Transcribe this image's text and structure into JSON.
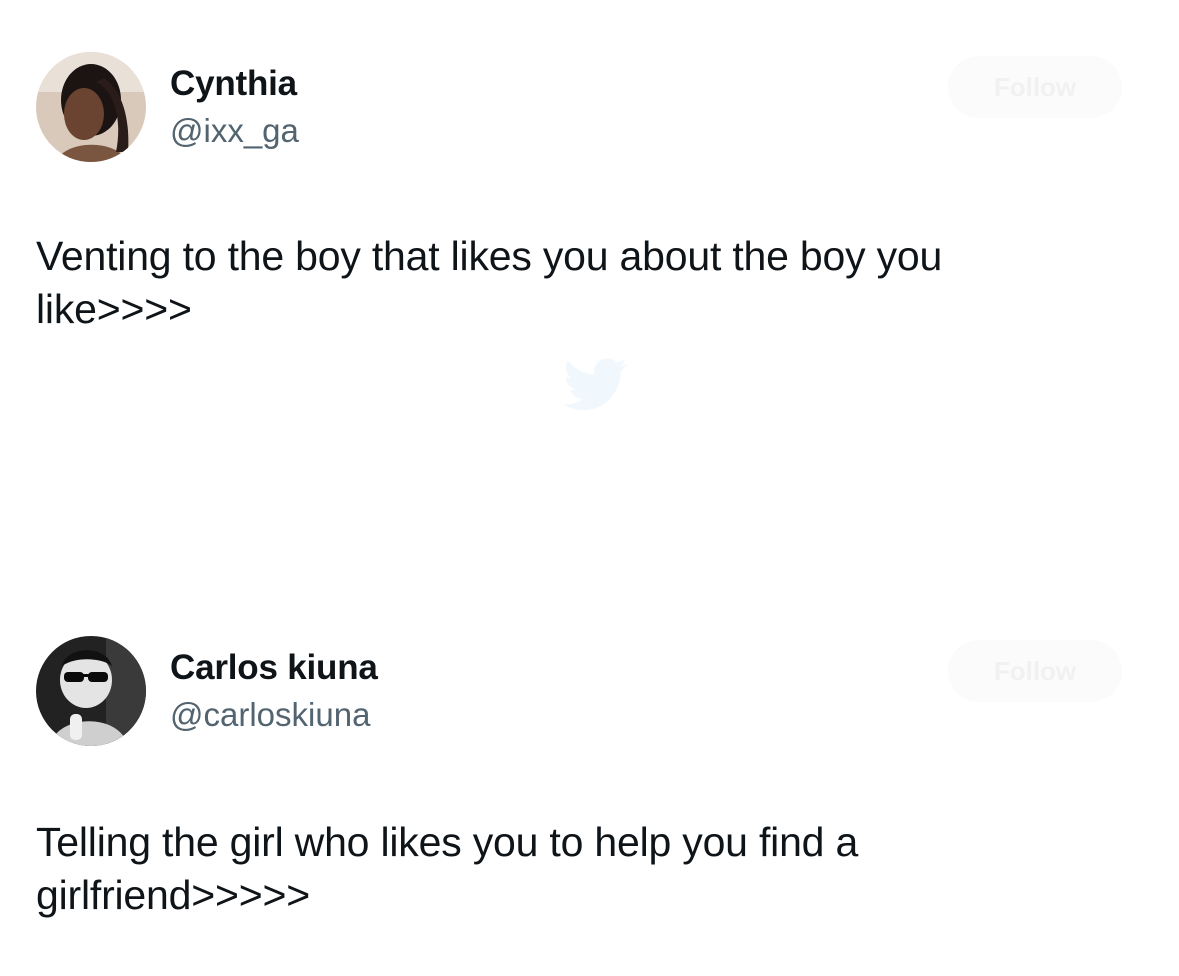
{
  "tweets": [
    {
      "name": "Cynthia",
      "handle": "@ixx_ga",
      "follow_label": "Follow",
      "text": "Venting to the boy that likes you about the boy you like>>>>"
    },
    {
      "name": "Carlos kiuna",
      "handle": "@carloskiuna",
      "follow_label": "Follow",
      "text": "Telling the girl who likes you to help you find a girlfriend>>>>>"
    }
  ],
  "colors": {
    "text": "#0f1419",
    "secondary": "#536471",
    "background": "#ffffff"
  },
  "icons": {
    "watermark": "twitter-bird-icon"
  }
}
